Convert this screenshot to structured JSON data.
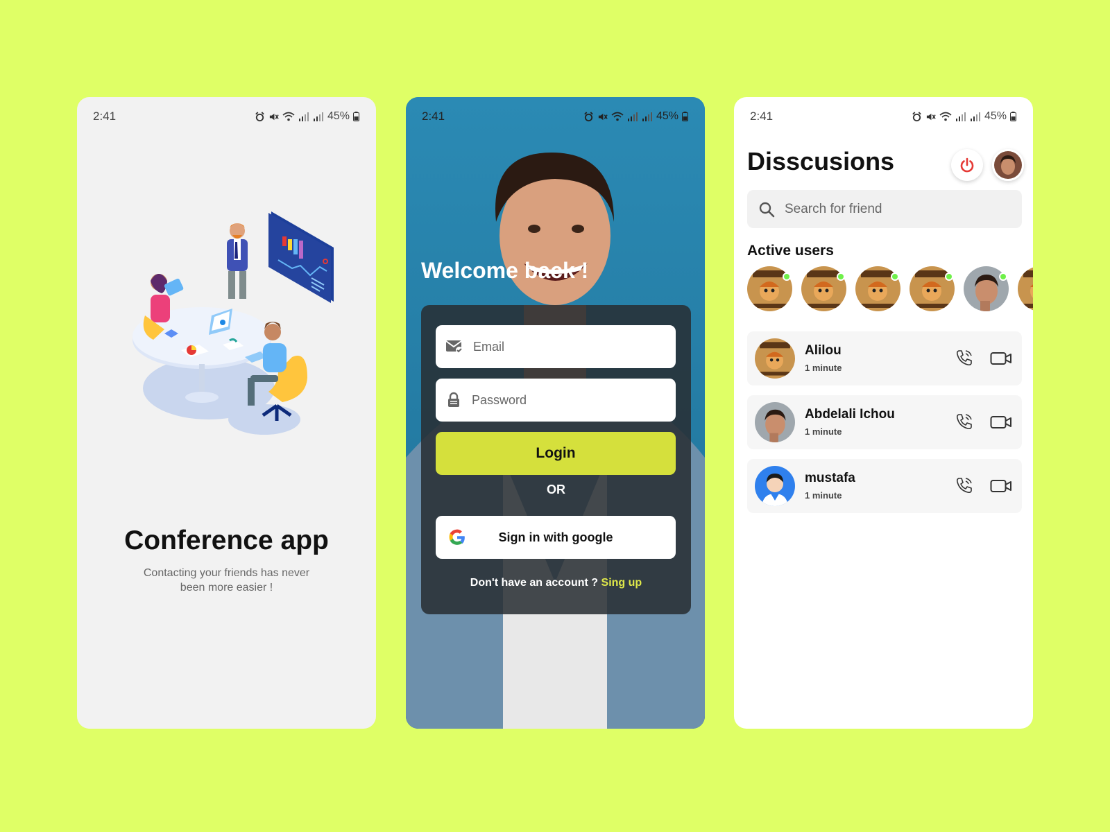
{
  "status_bar": {
    "time": "2:41",
    "battery": "45%"
  },
  "colors": {
    "background": "#dfff66",
    "accent": "#d5e03c",
    "online": "#6ff04a",
    "power": "#e53935"
  },
  "onboarding": {
    "illustration": "meeting-illustration",
    "title": "Conference app",
    "subtitle": "Contacting your friends has never been more easier !"
  },
  "login": {
    "welcome": "Welcome back !",
    "email_placeholder": "Email",
    "password_placeholder": "Password",
    "login_label": "Login",
    "or_label": "OR",
    "google_label": "Sign in with google",
    "no_account_text": "Don't have an account ?",
    "signup_label": "Sing up"
  },
  "discussions": {
    "title": "Disscusions",
    "search_placeholder": "Search for friend",
    "active_users_label": "Active users",
    "active_users": [
      {
        "avatar": "wanted-poster-avatar",
        "online": true
      },
      {
        "avatar": "wanted-poster-avatar",
        "online": true
      },
      {
        "avatar": "wanted-poster-avatar",
        "online": true
      },
      {
        "avatar": "wanted-poster-avatar",
        "online": true
      },
      {
        "avatar": "man-photo-avatar",
        "online": true
      },
      {
        "avatar": "wanted-poster-avatar",
        "online": false
      }
    ],
    "chats": [
      {
        "name": "Alilou",
        "time": "1 minute",
        "avatar": "wanted-poster-avatar"
      },
      {
        "name": "Abdelali Ichou",
        "time": "1 minute",
        "avatar": "man-photo-avatar"
      },
      {
        "name": "mustafa",
        "time": "1 minute",
        "avatar": "default-user-avatar"
      }
    ]
  }
}
